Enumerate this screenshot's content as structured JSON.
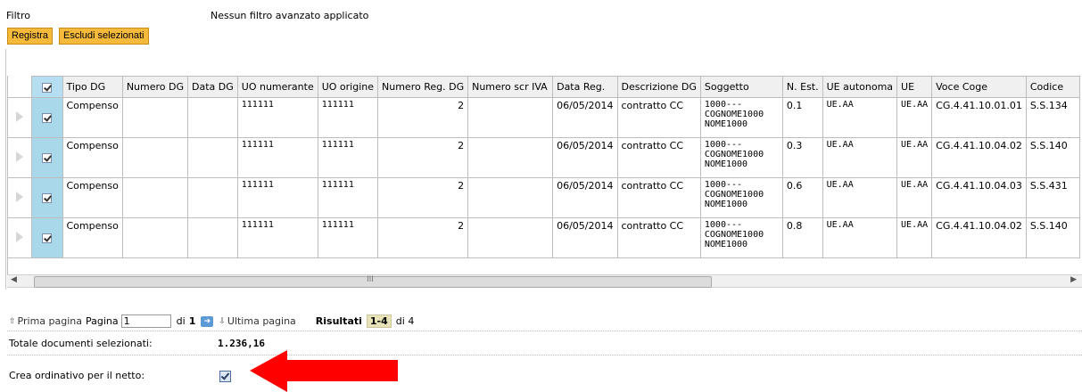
{
  "filter": {
    "label": "Filtro",
    "value": "Nessun filtro avanzato applicato"
  },
  "toolbar": {
    "register_label": "Registra",
    "exclude_label": "Escludi selezionati"
  },
  "grid": {
    "headers": [
      "Tipo DG",
      "Numero DG",
      "Data DG",
      "UO numerante",
      "UO origine",
      "Numero Reg. DG",
      "Numero scr IVA",
      "Data Reg.",
      "Descrizione DG",
      "Soggetto",
      "N. Est.",
      "UE autonoma",
      "UE",
      "Voce Coge",
      "Codice"
    ],
    "rows": [
      {
        "tipo": "Compenso",
        "numero_dg": "",
        "data_dg": "",
        "uo_num": "111111",
        "uo_orig": "111111",
        "num_reg": "2",
        "num_iva": "",
        "data_reg": "06/05/2014",
        "descr": "contratto CC",
        "sogg1": "1000---",
        "sogg2": "COGNOME1000",
        "sogg3": "NOME1000",
        "n_est": "0.1",
        "ue_auto": "UE.AA",
        "ue": "UE.AA",
        "voce": "CG.4.41.10.01.01",
        "codice": "S.S.134"
      },
      {
        "tipo": "Compenso",
        "numero_dg": "",
        "data_dg": "",
        "uo_num": "111111",
        "uo_orig": "111111",
        "num_reg": "2",
        "num_iva": "",
        "data_reg": "06/05/2014",
        "descr": "contratto CC",
        "sogg1": "1000---",
        "sogg2": "COGNOME1000",
        "sogg3": "NOME1000",
        "n_est": "0.3",
        "ue_auto": "UE.AA",
        "ue": "UE.AA",
        "voce": "CG.4.41.10.04.02",
        "codice": "S.S.140"
      },
      {
        "tipo": "Compenso",
        "numero_dg": "",
        "data_dg": "",
        "uo_num": "111111",
        "uo_orig": "111111",
        "num_reg": "2",
        "num_iva": "",
        "data_reg": "06/05/2014",
        "descr": "contratto CC",
        "sogg1": "1000---",
        "sogg2": "COGNOME1000",
        "sogg3": "NOME1000",
        "n_est": "0.6",
        "ue_auto": "UE.AA",
        "ue": "UE.AA",
        "voce": "CG.4.41.10.04.03",
        "codice": "S.S.431"
      },
      {
        "tipo": "Compenso",
        "numero_dg": "",
        "data_dg": "",
        "uo_num": "111111",
        "uo_orig": "111111",
        "num_reg": "2",
        "num_iva": "",
        "data_reg": "06/05/2014",
        "descr": "contratto CC",
        "sogg1": "1000---",
        "sogg2": "COGNOME1000",
        "sogg3": "NOME1000",
        "n_est": "0.8",
        "ue_auto": "UE.AA",
        "ue": "UE.AA",
        "voce": "CG.4.41.10.04.02",
        "codice": "S.S.140"
      }
    ]
  },
  "scrollbar": {
    "grip": "III"
  },
  "pager": {
    "first_label": "Prima pagina",
    "page_label": "Pagina",
    "page_value": "1",
    "of_label": "di",
    "total_pages": "1",
    "last_label": "Ultima pagina",
    "results_label": "Risultati",
    "results_range": "1-4",
    "results_of": "di 4"
  },
  "totals": {
    "label": "Totale documenti selezionati:",
    "value": "1.236,16"
  },
  "netto": {
    "label": "Crea ordinativo per il netto:",
    "checked": true
  },
  "colors": {
    "button_bg": "#f5b93b",
    "select_column": "#a8d8ea",
    "arrow": "#ff0000"
  }
}
